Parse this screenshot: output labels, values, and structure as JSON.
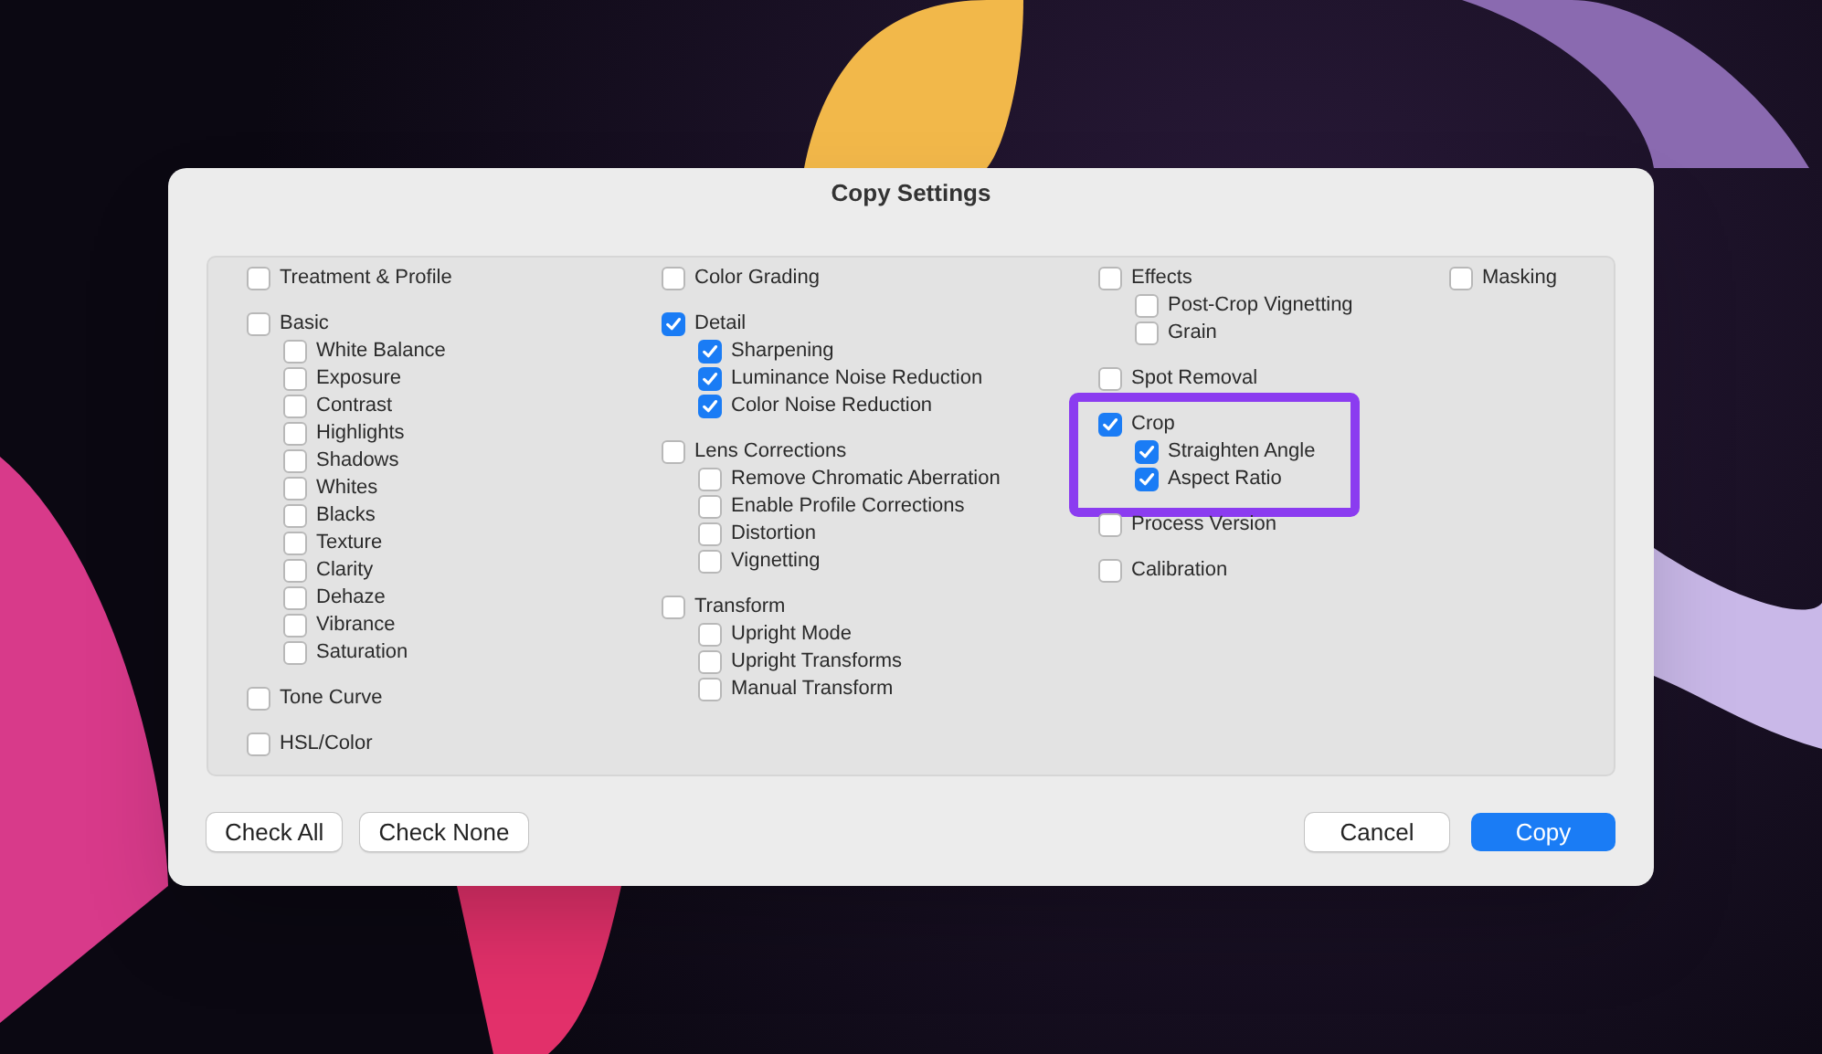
{
  "dialog": {
    "title": "Copy Settings"
  },
  "columns": [
    [
      {
        "label": "Treatment & Profile",
        "checked": false,
        "highlighted": false
      },
      {
        "label": "Basic",
        "checked": false,
        "highlighted": false,
        "children": [
          {
            "label": "White Balance",
            "checked": false
          },
          {
            "label": "Exposure",
            "checked": false
          },
          {
            "label": "Contrast",
            "checked": false
          },
          {
            "label": "Highlights",
            "checked": false
          },
          {
            "label": "Shadows",
            "checked": false
          },
          {
            "label": "Whites",
            "checked": false
          },
          {
            "label": "Blacks",
            "checked": false
          },
          {
            "label": "Texture",
            "checked": false
          },
          {
            "label": "Clarity",
            "checked": false
          },
          {
            "label": "Dehaze",
            "checked": false
          },
          {
            "label": "Vibrance",
            "checked": false
          },
          {
            "label": "Saturation",
            "checked": false
          }
        ]
      },
      {
        "label": "Tone Curve",
        "checked": false,
        "highlighted": false
      },
      {
        "label": "HSL/Color",
        "checked": false,
        "highlighted": false
      }
    ],
    [
      {
        "label": "Color Grading",
        "checked": false,
        "highlighted": false
      },
      {
        "label": "Detail",
        "checked": true,
        "highlighted": false,
        "children": [
          {
            "label": "Sharpening",
            "checked": true
          },
          {
            "label": "Luminance Noise Reduction",
            "checked": true
          },
          {
            "label": "Color Noise Reduction",
            "checked": true
          }
        ]
      },
      {
        "label": "Lens Corrections",
        "checked": false,
        "highlighted": false,
        "children": [
          {
            "label": "Remove Chromatic Aberration",
            "checked": false
          },
          {
            "label": "Enable Profile Corrections",
            "checked": false
          },
          {
            "label": "Distortion",
            "checked": false
          },
          {
            "label": "Vignetting",
            "checked": false
          }
        ]
      },
      {
        "label": "Transform",
        "checked": false,
        "highlighted": false,
        "children": [
          {
            "label": "Upright Mode",
            "checked": false
          },
          {
            "label": "Upright Transforms",
            "checked": false
          },
          {
            "label": "Manual Transform",
            "checked": false
          }
        ]
      }
    ],
    [
      {
        "label": "Effects",
        "checked": false,
        "highlighted": false,
        "children": [
          {
            "label": "Post-Crop Vignetting",
            "checked": false
          },
          {
            "label": "Grain",
            "checked": false
          }
        ]
      },
      {
        "label": "Spot Removal",
        "checked": false,
        "highlighted": false
      },
      {
        "label": "Crop",
        "checked": true,
        "highlighted": true,
        "children": [
          {
            "label": "Straighten Angle",
            "checked": true
          },
          {
            "label": "Aspect Ratio",
            "checked": true
          }
        ]
      },
      {
        "label": "Process Version",
        "checked": false,
        "highlighted": false
      },
      {
        "label": "Calibration",
        "checked": false,
        "highlighted": false
      }
    ],
    [
      {
        "label": "Masking",
        "checked": false,
        "highlighted": false
      }
    ]
  ],
  "left_buttons": [
    "Check All",
    "Check None"
  ],
  "right_buttons": [
    {
      "label": "Cancel",
      "kind": "secondary"
    },
    {
      "label": "Copy",
      "kind": "primary"
    }
  ]
}
